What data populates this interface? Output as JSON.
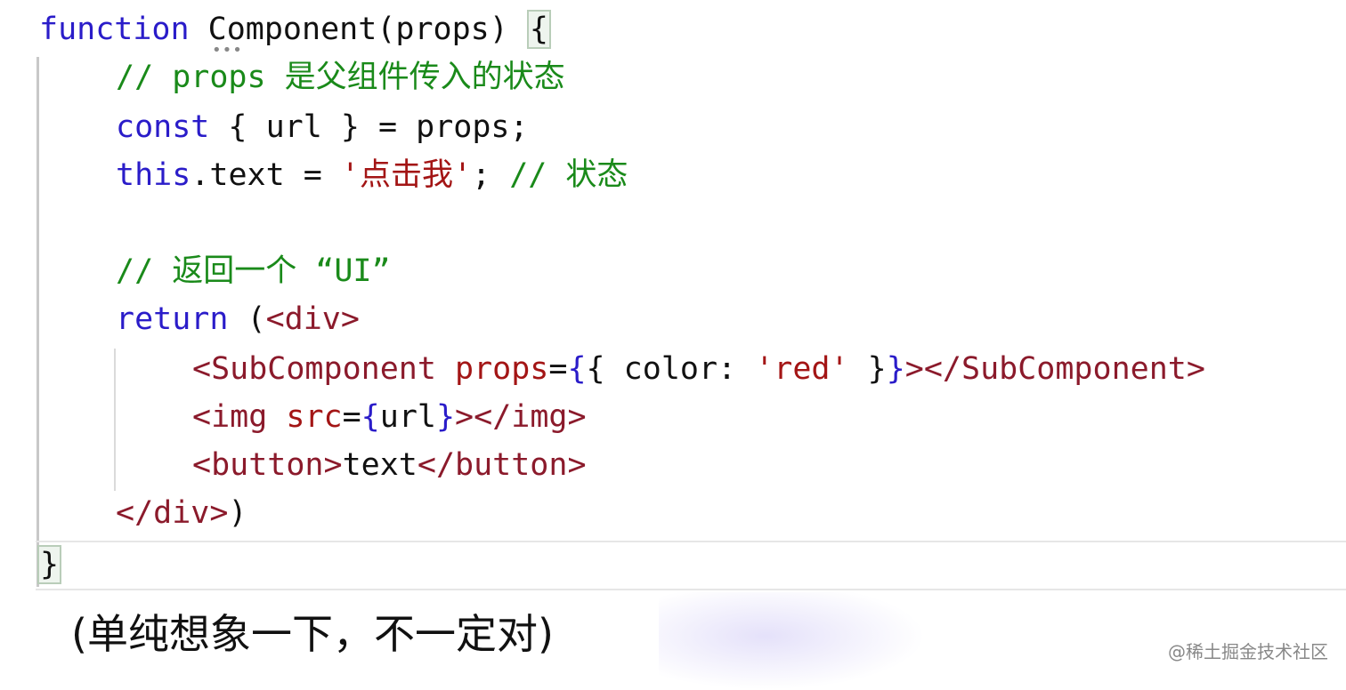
{
  "code": {
    "l1_kw": "function",
    "l1_name": " Component(props) ",
    "l1_brace": "{",
    "l2": "// props 是父组件传入的状态",
    "l3_kw": "const",
    "l3_rest": " { url } = props;",
    "l4_kw": "this",
    "l4_mid": ".text = ",
    "l4_str": "'点击我'",
    "l4_semi": "; ",
    "l4_cm": "// 状态",
    "l6": "// 返回一个 “UI”",
    "l7_kw": "return",
    "l7_paren": " (",
    "l7_tag": "<div>",
    "l8_open": "<SubComponent",
    "l8_sp": " ",
    "l8_attr": "props",
    "l8_eq": "=",
    "l8_b1": "{",
    "l8_obj": "{ color: ",
    "l8_str": "'red'",
    "l8_objend": " }",
    "l8_b2": "}",
    "l8_close": "></SubComponent>",
    "l9_open": "<img",
    "l9_sp": " ",
    "l9_attr": "src",
    "l9_eq": "=",
    "l9_b1": "{",
    "l9_val": "url",
    "l9_b2": "}",
    "l9_close": "></img>",
    "l10_open": "<button>",
    "l10_text": "text",
    "l10_close": "</button>",
    "l11_tag": "</div>",
    "l11_paren": ")",
    "l12": "}"
  },
  "colors": {
    "keyword": "#2a1cc9",
    "comment": "#1a8a1a",
    "string": "#a31515",
    "tag": "#8b1a2b"
  },
  "subtitle": "(单纯想象一下，不一定对)",
  "watermark": "@稀土掘金技术社区"
}
